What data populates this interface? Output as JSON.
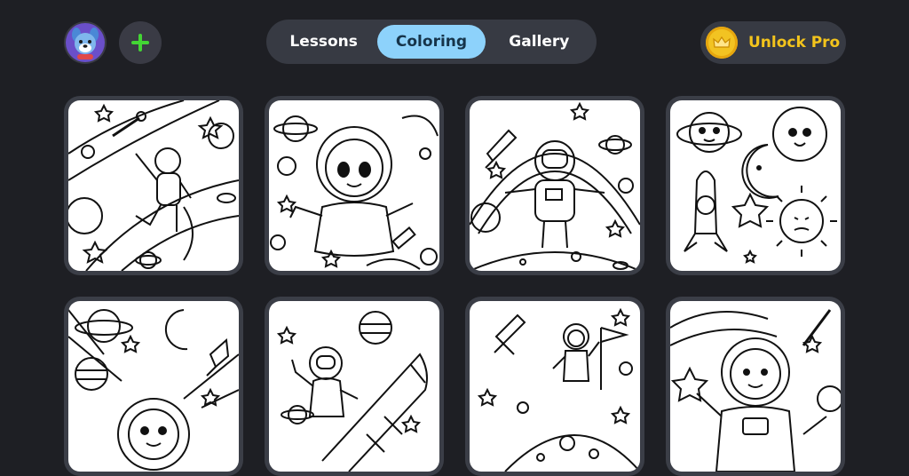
{
  "header": {
    "tabs": [
      {
        "label": "Lessons",
        "active": false
      },
      {
        "label": "Coloring",
        "active": true
      },
      {
        "label": "Gallery",
        "active": false
      }
    ],
    "unlock_label": "Unlock Pro"
  },
  "colors": {
    "background": "#1e1f24",
    "pill": "#373a43",
    "tab_active": "#8dd2fb",
    "pro_text": "#f3c41c",
    "add_icon": "#43d534"
  },
  "pages": [
    {
      "subject": "astronaut floating with comet and planets"
    },
    {
      "subject": "cute astronaut girl in space"
    },
    {
      "subject": "astronaut standing on moon with rocket"
    },
    {
      "subject": "cartoon planets, moon, sun and rocket"
    },
    {
      "subject": "astronaut with planets and rocket"
    },
    {
      "subject": "astronaut riding rocket"
    },
    {
      "subject": "astronaut kid with flag on moon"
    },
    {
      "subject": "astronaut boy holding star"
    }
  ]
}
